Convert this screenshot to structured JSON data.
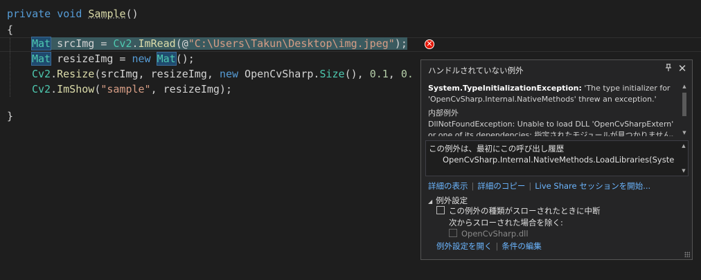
{
  "code": {
    "line1": {
      "kw_private": "private",
      "kw_void": "void",
      "method": "Sample",
      "parens": "()"
    },
    "line2": {
      "brace": "{"
    },
    "line3": {
      "type": "Mat",
      "mid": " srcImg = ",
      "cls": "Cv2",
      "dot": ".",
      "fn": "ImRead",
      "open": "(@",
      "str": "\"C:\\Users\\Takun\\Desktop\\img.jpeg\"",
      "close": ");"
    },
    "line4": {
      "type": "Mat",
      "mid": " resizeImg = ",
      "kw_new": "new",
      "type2": "Mat",
      "close": "();"
    },
    "line5": {
      "cls": "Cv2",
      "dot": ".",
      "fn": "Resize",
      "args": "(srcImg, resizeImg, ",
      "kw_new": "new",
      "ns": " OpenCvSharp.",
      "size": "Size",
      "p2": "(), ",
      "n1": "0.1",
      ",": ", ",
      "n2": "0."
    },
    "line6": {
      "cls": "Cv2",
      "dot": ".",
      "fn": "ImShow",
      "open": "(",
      "str": "\"sample\"",
      "close": ", resizeImg);"
    },
    "line8": {
      "brace": "}"
    }
  },
  "popup": {
    "title": "ハンドルされていない例外",
    "message": {
      "exception_type": "System.TypeInitializationException:",
      "exception_text": " 'The type initializer for 'OpenCvSharp.Internal.NativeMethods' threw an exception.'",
      "inner_heading": "内部例外",
      "inner_text": "DllNotFoundException: Unable to load DLL 'OpenCvSharpExtern' or one of its dependencies: 指定されたモジュールが見つかりません。"
    },
    "stack": {
      "title": "この例外は、最初にこの呼び出し履歴",
      "line": "OpenCvSharp.Internal.NativeMethods.LoadLibraries(System.Collect"
    },
    "links": {
      "details": "詳細の表示",
      "copy": "詳細のコピー",
      "liveshare": "Live Share セッションを開始..."
    },
    "settings": {
      "heading": "例外設定",
      "break_when_thrown": "この例外の種類がスローされたときに中断",
      "except_from": "次からスローされた場合を除く:",
      "dll": "OpenCvSharp.dll"
    },
    "footer": {
      "open_settings": "例外設定を開く",
      "edit_conditions": "条件の編集"
    }
  }
}
